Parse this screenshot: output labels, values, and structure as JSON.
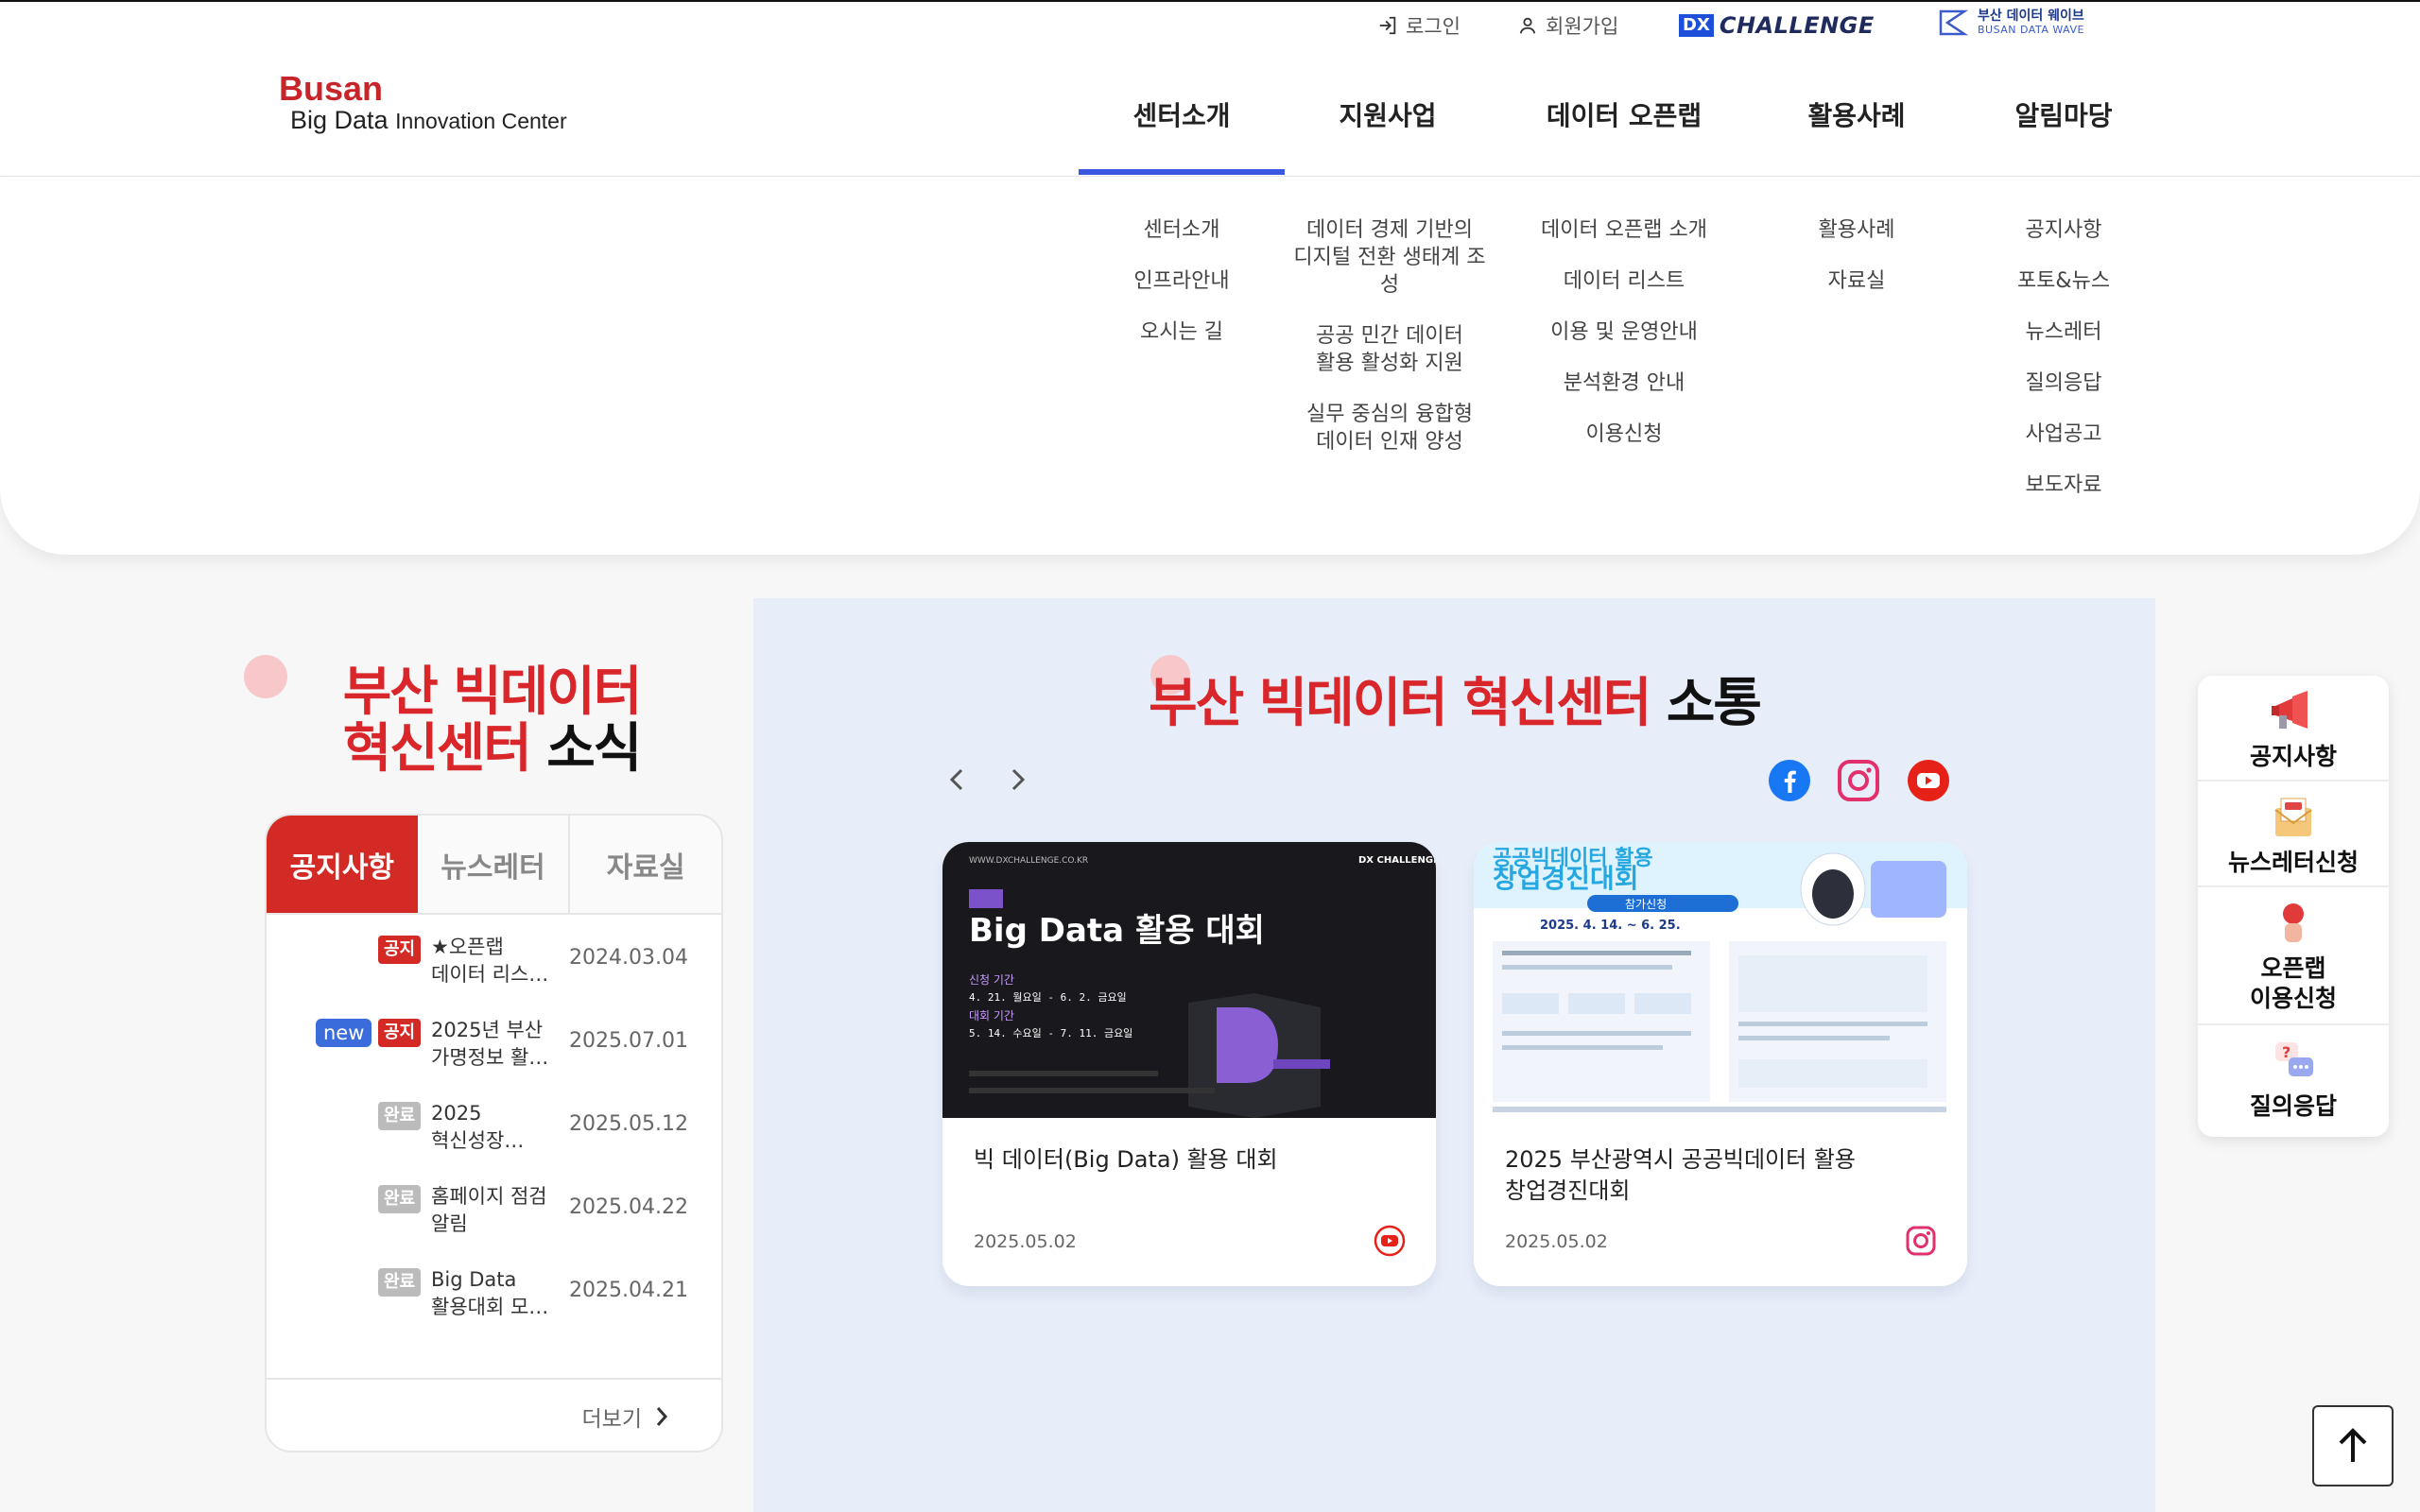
{
  "utility": {
    "login": "로그인",
    "signup": "회원가입",
    "dx_box": "DX",
    "dx_text": "CHALLENGE",
    "wave_ko": "부산 데이터 웨이브",
    "wave_en": "BUSAN DATA WAVE"
  },
  "logo": {
    "line1": "Busan",
    "line2a": "Big Data ",
    "line2b": "Innovation Center"
  },
  "gnb": [
    {
      "label": "센터소개",
      "active": true
    },
    {
      "label": "지원사업"
    },
    {
      "label": "데이터 오픈랩"
    },
    {
      "label": "활용사례"
    },
    {
      "label": "알림마당"
    }
  ],
  "mega": [
    [
      "센터소개",
      "인프라안내",
      "오시는 길"
    ],
    [
      "데이터 경제 기반의\n디지털 전환 생태계 조성",
      "공공 민간 데이터\n활용 활성화 지원",
      "실무 중심의 융합형\n데이터 인재 양성"
    ],
    [
      "데이터 오픈랩 소개",
      "데이터 리스트",
      "이용 및 운영안내",
      "분석환경 안내",
      "이용신청"
    ],
    [
      "활용사례",
      "자료실"
    ],
    [
      "공지사항",
      "포토&뉴스",
      "뉴스레터",
      "질의응답",
      "사업공고",
      "보도자료"
    ]
  ],
  "news": {
    "title_red1": "부산 빅데이터",
    "title_red2": "혁신센터 ",
    "title_black": "소식",
    "tabs": [
      "공지사항",
      "뉴스레터",
      "자료실"
    ],
    "items": [
      {
        "badges": [
          {
            "text": "공지",
            "type": "red"
          }
        ],
        "title": "★오픈랩\n데이터 리스…",
        "date": "2024.03.04"
      },
      {
        "badges": [
          {
            "text": "new",
            "type": "blue"
          },
          {
            "text": "공지",
            "type": "red"
          }
        ],
        "title": "2025년 부산\n가명정보 활…",
        "date": "2025.07.01"
      },
      {
        "badges": [
          {
            "text": "완료",
            "type": "gray"
          }
        ],
        "title": "2025\n혁신성장…",
        "date": "2025.05.12"
      },
      {
        "badges": [
          {
            "text": "완료",
            "type": "gray"
          }
        ],
        "title": "홈페이지 점검\n알림",
        "date": "2025.04.22"
      },
      {
        "badges": [
          {
            "text": "완료",
            "type": "gray"
          }
        ],
        "title": "Big Data\n활용대회 모…",
        "date": "2025.04.21"
      }
    ],
    "more": "더보기"
  },
  "comm": {
    "title_red": "부산 빅데이터 혁신센터 ",
    "title_black": "소통",
    "cards": [
      {
        "title": "빅 데이터(Big Data) 활용 대회",
        "date": "2025.05.02",
        "sns": "youtube-icon",
        "img": {
          "site": "WWW.DXCHALLENGE.CO.KR",
          "brand": "DX CHALLENGE",
          "headline": "Big Data 활용 대회",
          "l1": "신청 기간",
          "l1v": "4. 21. 월요일  -  6. 2. 금요일",
          "l2": "대회 기간",
          "l2v": "5. 14. 수요일  -  7. 11. 금요일"
        }
      },
      {
        "title": "2025 부산광역시 공공빅데이터 활용\n창업경진대회",
        "date": "2025.05.02",
        "sns": "instagram-icon",
        "img": {
          "headline": "공공빅데이터 활용\n창업경진대회",
          "sub": "참가신청",
          "period": "2025. 4. 14.  ~  6. 25."
        }
      }
    ]
  },
  "quick": [
    {
      "label": "공지사항",
      "icon": "megaphone-icon"
    },
    {
      "label": "뉴스레터신청",
      "icon": "newsletter-icon"
    },
    {
      "label": "오픈랩\n이용신청",
      "icon": "openlab-icon"
    },
    {
      "label": "질의응답",
      "icon": "qna-icon"
    }
  ],
  "colors": {
    "brand_red": "#d32a26",
    "accent_blue": "#3a57e0",
    "comm_bg": "#e8eef9"
  }
}
